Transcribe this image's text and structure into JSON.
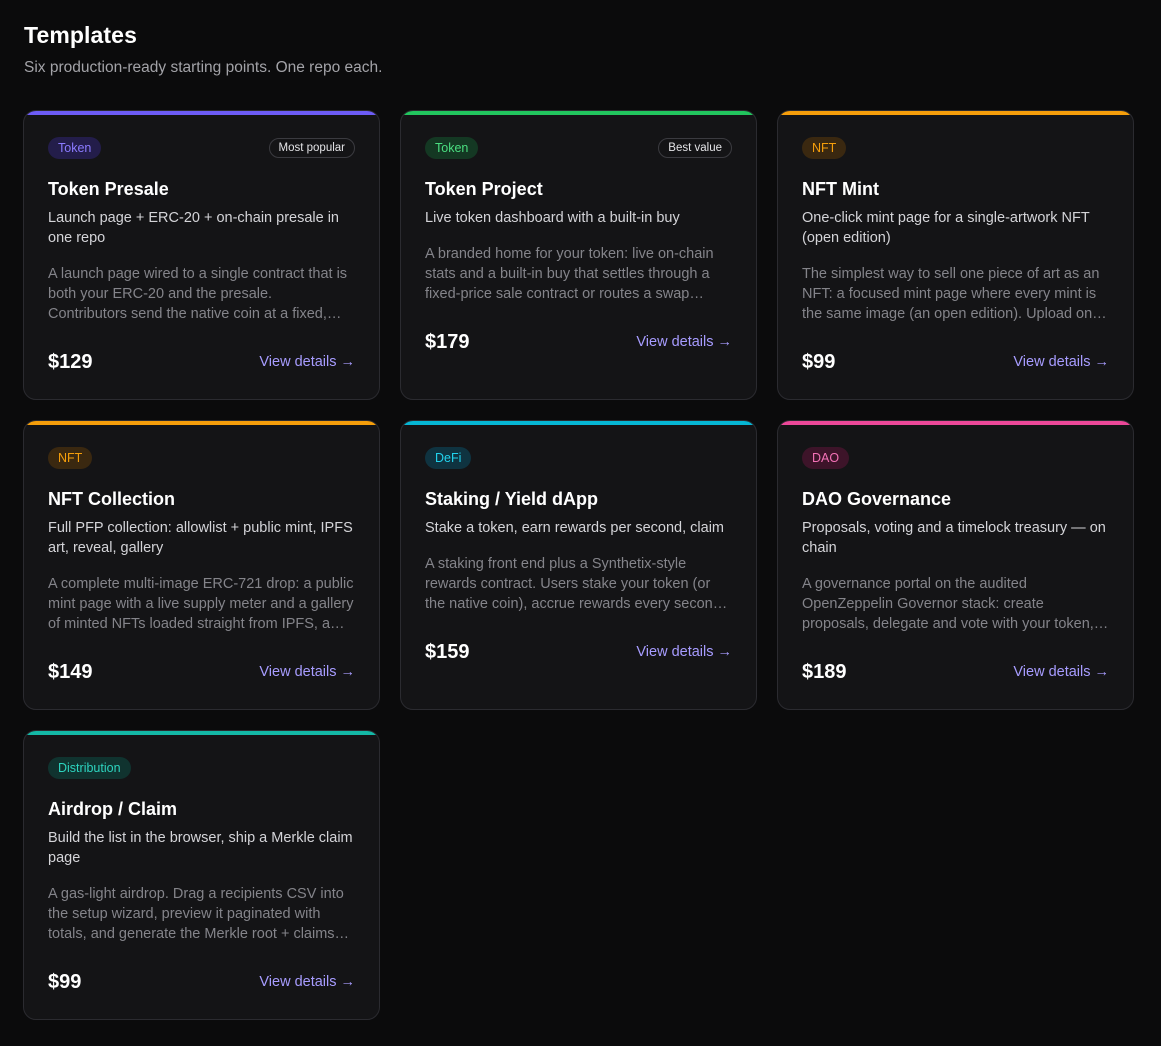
{
  "header": {
    "title": "Templates",
    "subtitle": "Six production-ready starting points. One repo each."
  },
  "view_details_label": "View details",
  "arrow_glyph": "→",
  "cards": [
    {
      "accent": "#6d5cf6",
      "tag": "Token",
      "tag_text_color": "#8b7bff",
      "tag_bg": "#231d4a",
      "badge": "Most popular",
      "title": "Token Presale",
      "tagline": "Launch page + ERC-20 + on-chain presale in one repo",
      "description": "A launch page wired to a single contract that is both your ERC-20 and the presale. Contributors send the native coin at a fixed,…",
      "price": "$129"
    },
    {
      "accent": "#22c55e",
      "tag": "Token",
      "tag_text_color": "#4ade80",
      "tag_bg": "#143823",
      "badge": "Best value",
      "title": "Token Project",
      "tagline": "Live token dashboard with a built-in buy",
      "description": "A branded home for your token: live on-chain stats and a built-in buy that settles through a fixed-price sale contract or routes a swap…",
      "price": "$179"
    },
    {
      "accent": "#f59e0b",
      "tag": "NFT",
      "tag_text_color": "#f59e0b",
      "tag_bg": "#3a2810",
      "badge": "",
      "title": "NFT Mint",
      "tagline": "One-click mint page for a single-artwork NFT (open edition)",
      "description": "The simplest way to sell one piece of art as an NFT: a focused mint page where every mint is the same image (an open edition). Upload on…",
      "price": "$99"
    },
    {
      "accent": "#f59e0b",
      "tag": "NFT",
      "tag_text_color": "#f59e0b",
      "tag_bg": "#3a2810",
      "badge": "",
      "title": "NFT Collection",
      "tagline": "Full PFP collection: allowlist + public mint, IPFS art, reveal, gallery",
      "description": "A complete multi-image ERC-721 drop: a public mint page with a live supply meter and a gallery of minted NFTs loaded straight from IPFS, a…",
      "price": "$149"
    },
    {
      "accent": "#06b6d4",
      "tag": "DeFi",
      "tag_text_color": "#22d3ee",
      "tag_bg": "#0f3340",
      "badge": "",
      "title": "Staking / Yield dApp",
      "tagline": "Stake a token, earn rewards per second, claim",
      "description": "A staking front end plus a Synthetix-style rewards contract. Users stake your token (or the native coin), accrue rewards every secon…",
      "price": "$159"
    },
    {
      "accent": "#ec4899",
      "tag": "DAO",
      "tag_text_color": "#f472b6",
      "tag_bg": "#3d1429",
      "badge": "",
      "title": "DAO Governance",
      "tagline": "Proposals, voting and a timelock treasury — on chain",
      "description": "A governance portal on the audited OpenZeppelin Governor stack: create proposals, delegate and vote with your token,…",
      "price": "$189"
    },
    {
      "accent": "#14b8a6",
      "tag": "Distribution",
      "tag_text_color": "#2dd4bf",
      "tag_bg": "#10332f",
      "badge": "",
      "title": "Airdrop / Claim",
      "tagline": "Build the list in the browser, ship a Merkle claim page",
      "description": "A gas-light airdrop. Drag a recipients CSV into the setup wizard, preview it paginated with totals, and generate the Merkle root + claims…",
      "price": "$99"
    }
  ]
}
